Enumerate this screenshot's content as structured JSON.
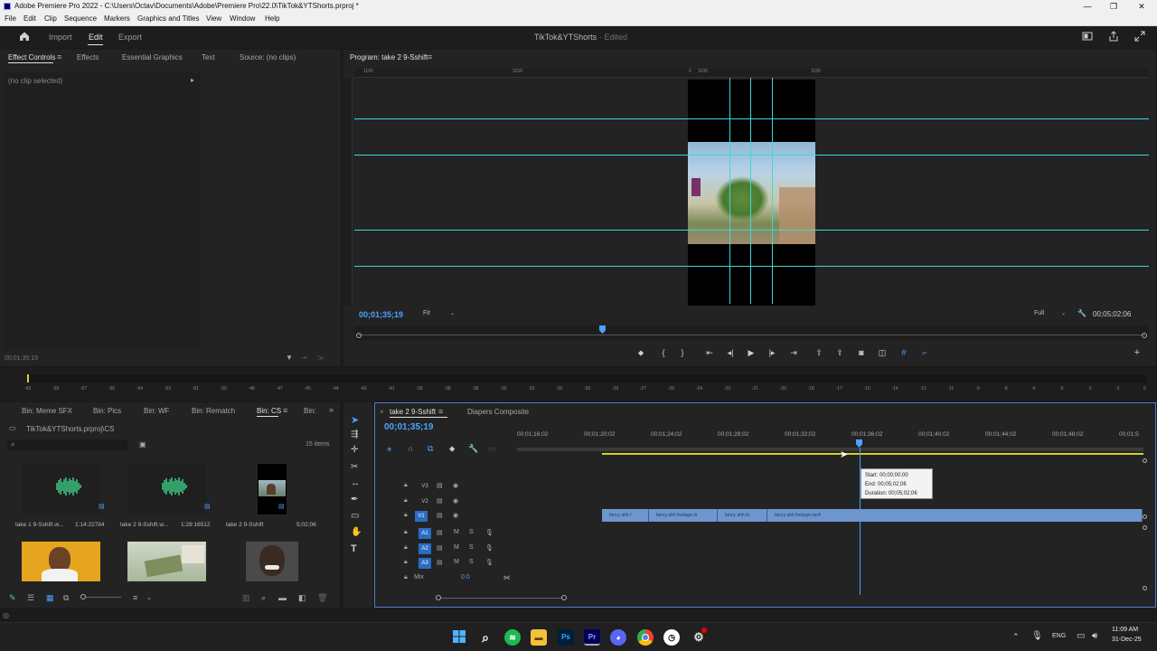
{
  "window": {
    "title": "Adobe Premiere Pro 2022 - C:\\Users\\Octav\\Documents\\Adobe\\Premiere Pro\\22.0\\TikTok&YTShorts.prproj *",
    "minimize": "—",
    "maximize": "❐",
    "close": "✕"
  },
  "menu": [
    "File",
    "Edit",
    "Clip",
    "Sequence",
    "Markers",
    "Graphics and Titles",
    "View",
    "Window",
    "Help"
  ],
  "header": {
    "tabs": [
      "Import",
      "Edit",
      "Export"
    ],
    "active_tab": "Edit",
    "project_name": "TikTok&YTShorts",
    "project_status": "- Edited"
  },
  "effect_controls": {
    "tabs": [
      "Effect Controls",
      "Effects",
      "Essential Graphics",
      "Text",
      "Source: (no clips)"
    ],
    "no_clip": "(no clip selected)",
    "timecode": "00;01;35;19"
  },
  "program_monitor": {
    "title": "Program: take 2 9-Sshift",
    "timecode": "00;01;35;19",
    "zoom": "Fit",
    "quality": "Full",
    "duration": "00;05;02;06",
    "top_ruler": [
      "1100",
      "1150",
      "0",
      "1100",
      "1150"
    ]
  },
  "audio_meter": {
    "scale": [
      "-60",
      "-59",
      "-57",
      "-56",
      "-54",
      "-53",
      "-51",
      "-50",
      "-48",
      "-47",
      "-45",
      "-44",
      "-42",
      "-41",
      "-39",
      "-38",
      "-36",
      "-35",
      "-33",
      "-32",
      "-30",
      "-29",
      "-27",
      "-26",
      "-24",
      "-23",
      "-21",
      "-20",
      "-18",
      "-17",
      "-15",
      "-14",
      "-12",
      "-11",
      "-9",
      "-8",
      "-6",
      "-5",
      "-3",
      "-2",
      "0"
    ],
    "scale_display": "-60 … 0"
  },
  "project_panel": {
    "bins": [
      "Bin: Meme SFX",
      "Bin: Pics",
      "Bin: WF",
      "Bin: Rematch",
      "Bin: CS",
      "Bin:"
    ],
    "active_bin": "Bin: CS",
    "path": "TikTok&YTShorts.prproj\\CS",
    "items_count": "15 items",
    "items": [
      {
        "name": "take 1 9-Sshift.w...",
        "duration": "1:14:22784"
      },
      {
        "name": "take 2 9-Sshift.w...",
        "duration": "1:29:16512"
      },
      {
        "name": "take 2 9-Sshift",
        "duration": "5;02;06"
      }
    ]
  },
  "timeline": {
    "tabs": [
      "take 2 9-Sshift",
      "Diapers Composite"
    ],
    "timecode": "00;01;35;19",
    "ruler": [
      "00;01;16;02",
      "00;01;20;02",
      "00;01;24;02",
      "00;01;28;02",
      "00;01;32;02",
      "00;01;36;02",
      "00;01;40;02",
      "00;01;44;02",
      "00;01;48;02",
      "00;01;5"
    ],
    "tracks": [
      "V3",
      "V2",
      "V1",
      "A1",
      "A2",
      "A3"
    ],
    "mix_label": "Mix",
    "mix_value": "0.0",
    "clips": [
      "fancy ahh f",
      "fancy ahh footage.m",
      "fancy ahh fo",
      "fancy ahh footage.mp4"
    ],
    "tooltip": {
      "start": "Start: 00;00;00;00",
      "end": "End: 00;05;02;06",
      "duration": "Duration: 00;05;02;06"
    }
  },
  "taskbar": {
    "lang": "ENG",
    "time": "11:09 AM",
    "date": "31-Dec-25"
  }
}
